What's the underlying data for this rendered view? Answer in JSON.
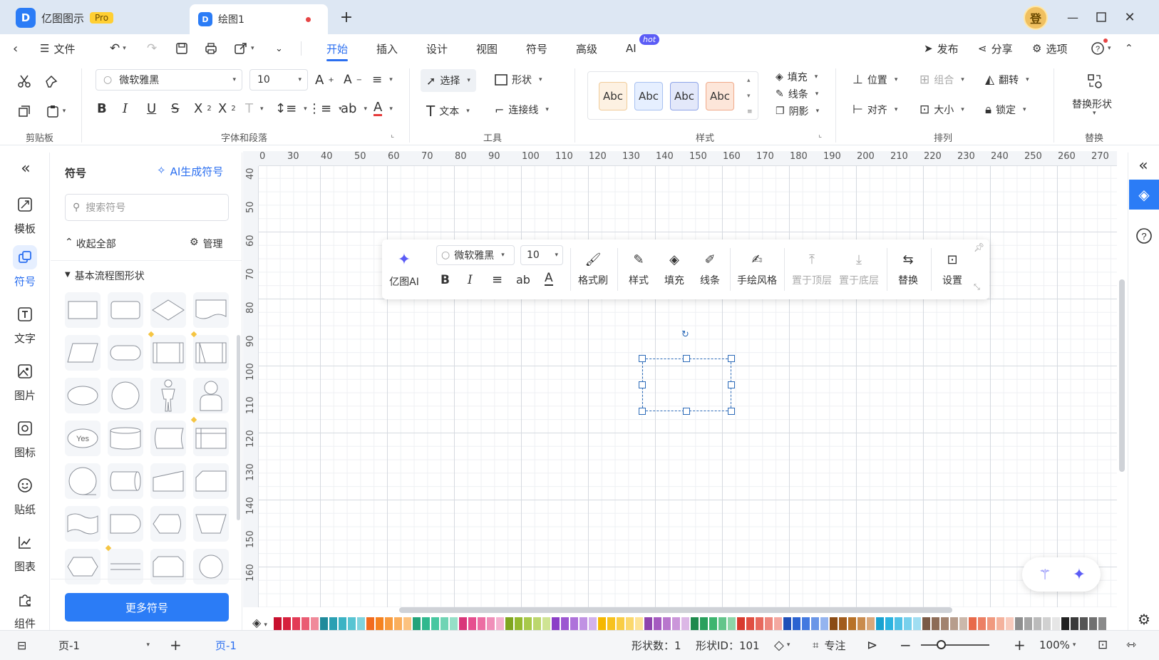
{
  "titlebar": {
    "app_name": "亿图图示",
    "pro_badge": "Pro",
    "doc_tab": "绘图1",
    "avatar_text": "登"
  },
  "menubar": {
    "file": "文件",
    "tabs": [
      "开始",
      "插入",
      "设计",
      "视图",
      "符号",
      "高级",
      "AI"
    ],
    "active_tab": "开始",
    "hot_badge": "hot",
    "publish": "发布",
    "share": "分享",
    "options": "选项"
  },
  "ribbon": {
    "font_name": "微软雅黑",
    "font_size": "10",
    "select": "选择",
    "shape": "形状",
    "text": "文本",
    "connector": "连接线",
    "style_sample": "Abc",
    "fill": "填充",
    "line": "线条",
    "shadow": "阴影",
    "position": "位置",
    "group": "组合",
    "flip": "翻转",
    "align": "对齐",
    "size": "大小",
    "lock": "锁定",
    "replace_shape": "替换形状",
    "groups": {
      "clipboard": "剪贴板",
      "font_para": "字体和段落",
      "tools": "工具",
      "styles": "样式",
      "arrange": "排列",
      "replace": "替换"
    }
  },
  "leftbar": {
    "items": [
      "模板",
      "符号",
      "文字",
      "图片",
      "图标",
      "贴纸",
      "图表",
      "组件"
    ],
    "active": "符号"
  },
  "symbols": {
    "title": "符号",
    "ai_generate": "AI生成符号",
    "search_placeholder": "搜索符号",
    "collapse_all": "收起全部",
    "manage": "管理",
    "category": "基本流程图形状",
    "yes_label": "Yes",
    "more_button": "更多符号"
  },
  "ruler": {
    "h": [
      "0",
      "30",
      "40",
      "50",
      "60",
      "70",
      "80",
      "90",
      "100",
      "110",
      "120",
      "130",
      "140",
      "150",
      "160",
      "170",
      "180",
      "190",
      "200",
      "210",
      "220",
      "230",
      "240",
      "250",
      "260",
      "270"
    ],
    "v": [
      "40",
      "50",
      "60",
      "70",
      "80",
      "90",
      "100",
      "110",
      "120",
      "130",
      "140",
      "150",
      "160"
    ]
  },
  "floatbar": {
    "ai": "亿图AI",
    "font_name": "微软雅黑",
    "font_size": "10",
    "format_painter": "格式刷",
    "style": "样式",
    "fill": "填充",
    "line": "线条",
    "hand_drawn": "手绘风格",
    "bring_front": "置于顶层",
    "send_back": "置于底层",
    "replace": "替换",
    "settings": "设置"
  },
  "statusbar": {
    "page_select": "页-1",
    "page_tab": "页-1",
    "shape_count": "形状数：1",
    "shape_id": "形状ID：101",
    "focus": "专注",
    "zoom": "100%"
  },
  "palette_colors": [
    "#c8102e",
    "#d6203c",
    "#e33b56",
    "#ea5c73",
    "#f08a9a",
    "#1f8a9b",
    "#2aa0b3",
    "#3bb3c4",
    "#58c4d2",
    "#7fd3dd",
    "#f26b1d",
    "#f5821f",
    "#f89a3d",
    "#faae5c",
    "#fcc27f",
    "#23a37a",
    "#2fb88e",
    "#47c7a0",
    "#6fd4b4",
    "#96e0c8",
    "#d9367a",
    "#e64f8f",
    "#ec6da3",
    "#f08fb9",
    "#f4b1cf",
    "#7fa51f",
    "#94b92f",
    "#a8c94b",
    "#bcd76e",
    "#cfe493",
    "#8b3fc7",
    "#9c56d1",
    "#ae72da",
    "#c092e3",
    "#d3b3ec",
    "#f5b800",
    "#f7c21f",
    "#f9cd45",
    "#fbd86d",
    "#fde396",
    "#8e44ad",
    "#a55bc0",
    "#b877cd",
    "#cb96da",
    "#dcb7e6",
    "#1e8a4c",
    "#29a05c",
    "#3db56f",
    "#63c58b",
    "#8dd5a8",
    "#d83a2e",
    "#e04f42",
    "#e7695d",
    "#ee877d",
    "#f4a8a0",
    "#1f4fb8",
    "#2b63d1",
    "#4279e0",
    "#6a96e7",
    "#94b4ef",
    "#8a4b14",
    "#a15c1c",
    "#b87227",
    "#c98c4e",
    "#d9a87b",
    "#19a2d1",
    "#2bb3e0",
    "#4fc1e6",
    "#78d0ec",
    "#a0def2",
    "#7a5a46",
    "#8d6c57",
    "#a2836f",
    "#b79d8c",
    "#cbb8ab",
    "#e86a4a",
    "#ec8064",
    "#f0997f",
    "#f4b29d",
    "#f8cbbd",
    "#8f8f8f",
    "#a5a5a5",
    "#bbbbbb",
    "#d1d1d1",
    "#e6e6e6",
    "#222222",
    "#3a3a3a",
    "#555555",
    "#707070",
    "#8a8a8a"
  ]
}
